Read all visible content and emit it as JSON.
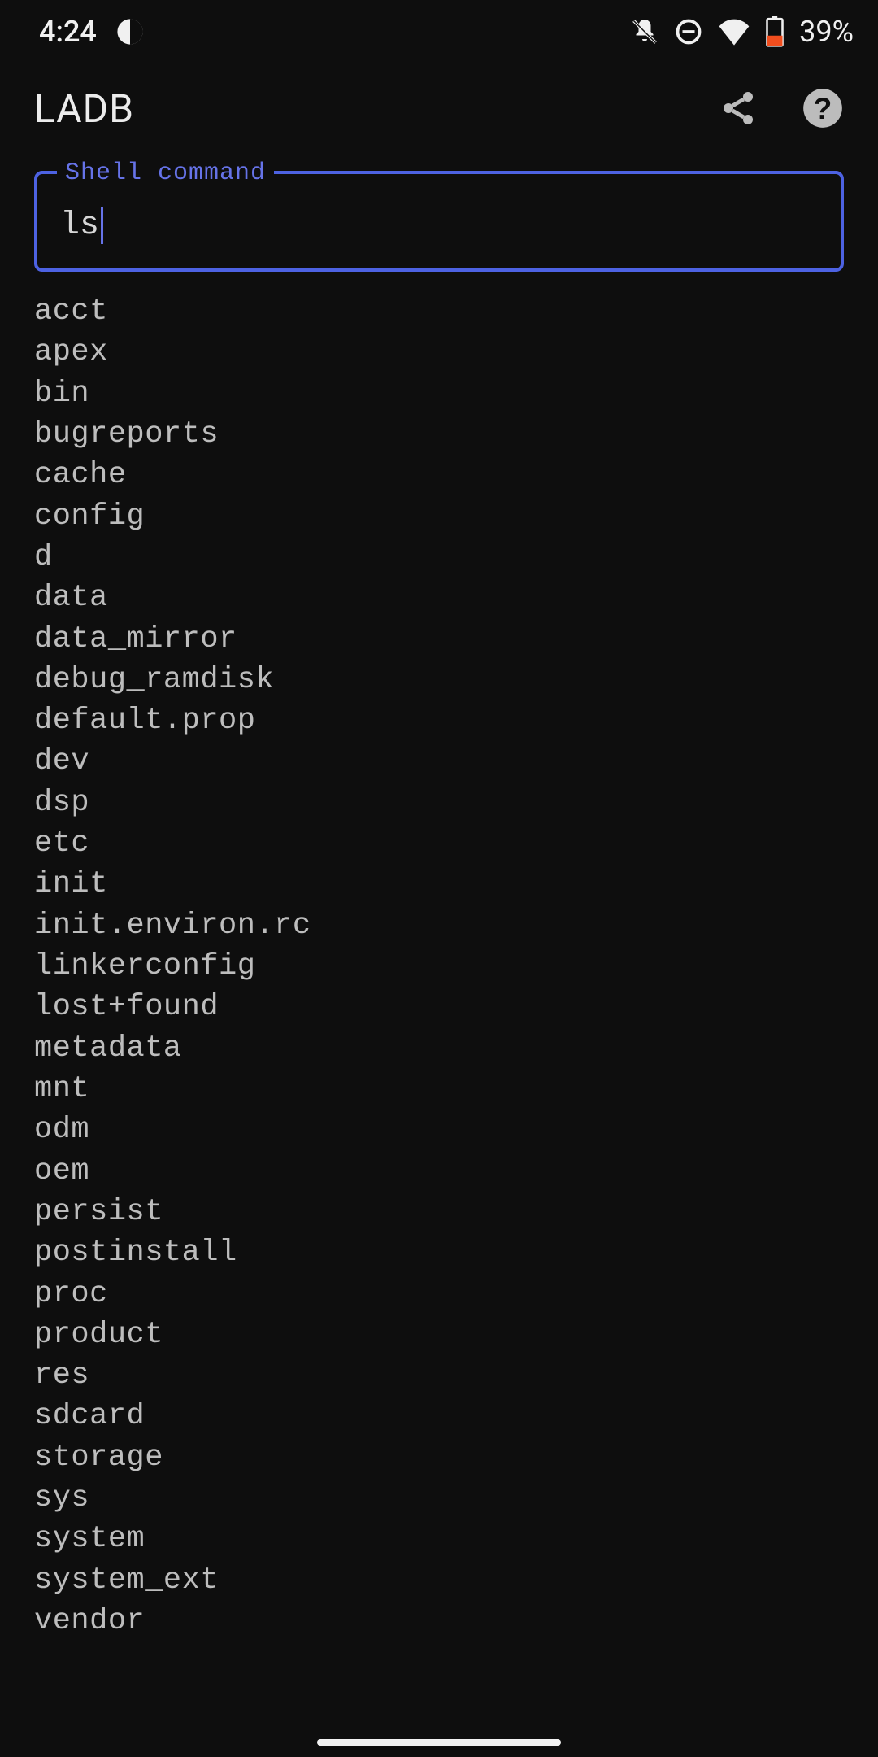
{
  "status": {
    "time": "4:24",
    "battery_pct": "39%"
  },
  "app": {
    "title": "LADB"
  },
  "field": {
    "legend": "Shell command",
    "value": "ls"
  },
  "output": [
    "acct",
    "apex",
    "bin",
    "bugreports",
    "cache",
    "config",
    "d",
    "data",
    "data_mirror",
    "debug_ramdisk",
    "default.prop",
    "dev",
    "dsp",
    "etc",
    "init",
    "init.environ.rc",
    "linkerconfig",
    "lost+found",
    "metadata",
    "mnt",
    "odm",
    "oem",
    "persist",
    "postinstall",
    "proc",
    "product",
    "res",
    "sdcard",
    "storage",
    "sys",
    "system",
    "system_ext",
    "vendor"
  ]
}
